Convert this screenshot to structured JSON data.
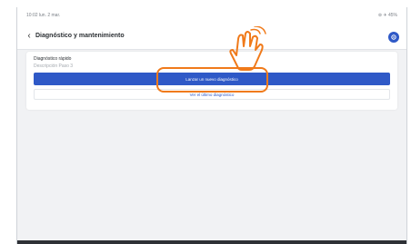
{
  "status_bar": {
    "time": "10:02 lun. 2 mar.",
    "right": "⊚ ✈ 45%"
  },
  "toolbar": {
    "back_icon": "‹",
    "title": "Diagnóstico y mantenimiento"
  },
  "card": {
    "title": "Diagnóstico rápido",
    "subtitle": "Descripción Paso 3",
    "primary_button": "Lanzar un nuevo diagnóstico",
    "secondary_button": "Ver el último diagnóstico"
  },
  "colors": {
    "accent": "#2f59c7",
    "highlight": "#f07a1a"
  },
  "icons": {
    "back": "chevron-left-icon",
    "settings": "gear-icon",
    "hand": "pointing-hand-icon"
  }
}
